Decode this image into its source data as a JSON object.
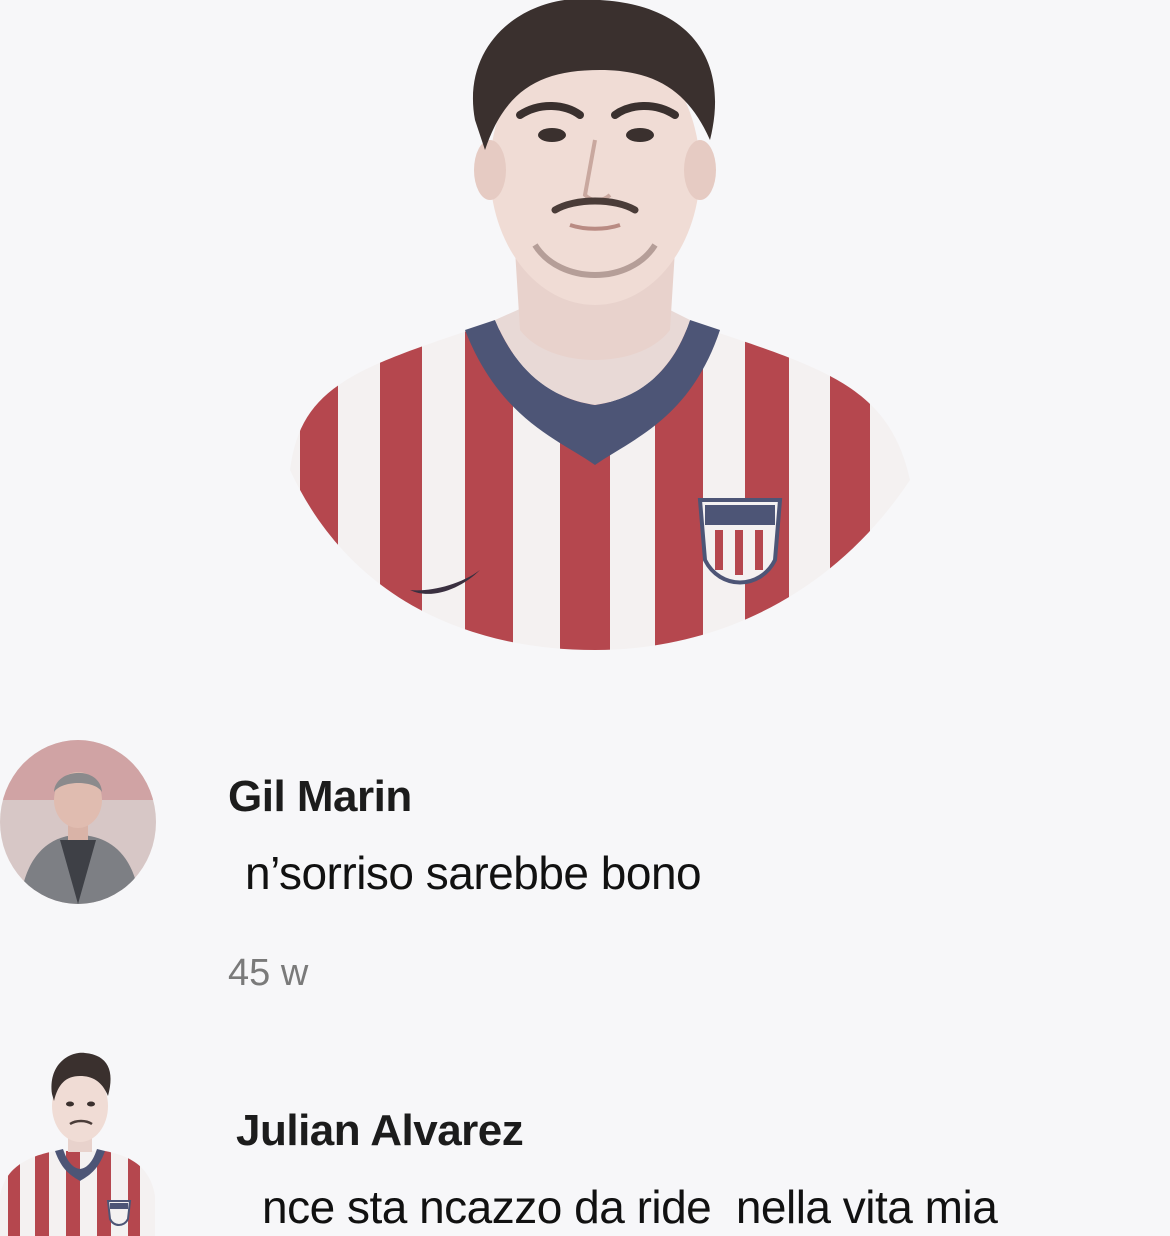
{
  "post": {
    "image_icon": "player-portrait"
  },
  "comments": [
    {
      "author": "Gil Marin",
      "text": "n’sorriso sarebbe bono",
      "time": "45 w",
      "avatar_icon": "man-in-suit-avatar"
    },
    {
      "author": "Julian Alvarez",
      "text": "nce sta ncazzo da ride  nella vita mia",
      "avatar_icon": "player-cutout-avatar"
    }
  ],
  "colors": {
    "background": "#f7f7f9",
    "kit_red": "#b5474e",
    "kit_white": "#f4f1f1",
    "collar_navy": "#4d5576",
    "meta_gray": "#7a7a7a"
  }
}
